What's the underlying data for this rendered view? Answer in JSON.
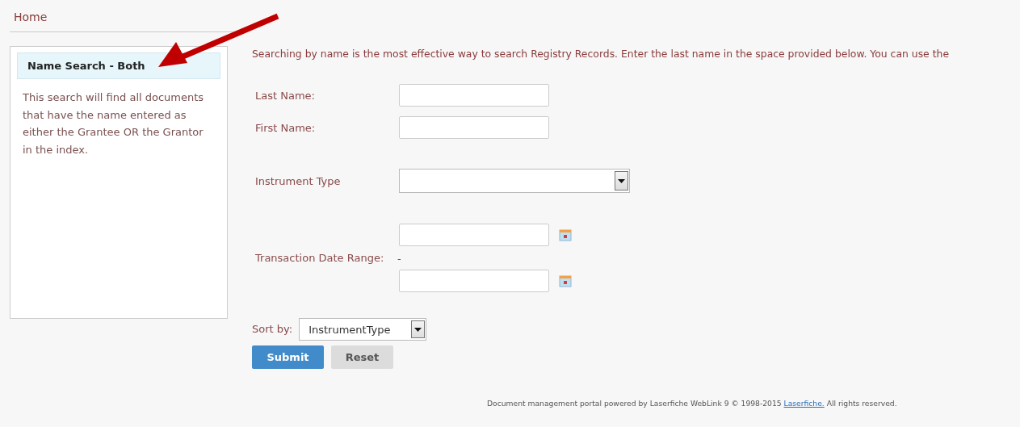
{
  "breadcrumb": "Home",
  "sidebar": {
    "title": "Name Search - Both",
    "description": "This search will find all documents that have the name entered as either the Grantee OR the Grantor in the index."
  },
  "intro": "Searching by name is the most effective way to search Registry Records. Enter the last name in the space provided below. You can use the",
  "fields": [
    {
      "kind": "text",
      "label": "Last Name:"
    },
    {
      "kind": "text",
      "label": "First Name:"
    },
    {
      "kind": "select",
      "label": "Instrument Type"
    },
    {
      "kind": "daterange",
      "label": "Transaction Date Range:",
      "separator": "-"
    }
  ],
  "sort": {
    "label": "Sort by:",
    "value": "InstrumentType"
  },
  "buttons": [
    {
      "label": "Submit",
      "kind": "primary"
    },
    {
      "label": "Reset",
      "kind": "secondary"
    }
  ],
  "footer": {
    "text": "Document management portal powered by Laserfiche WebLink 9 © 1998-2015",
    "link": "Laserfiche.",
    "suffix": "All rights reserved."
  }
}
